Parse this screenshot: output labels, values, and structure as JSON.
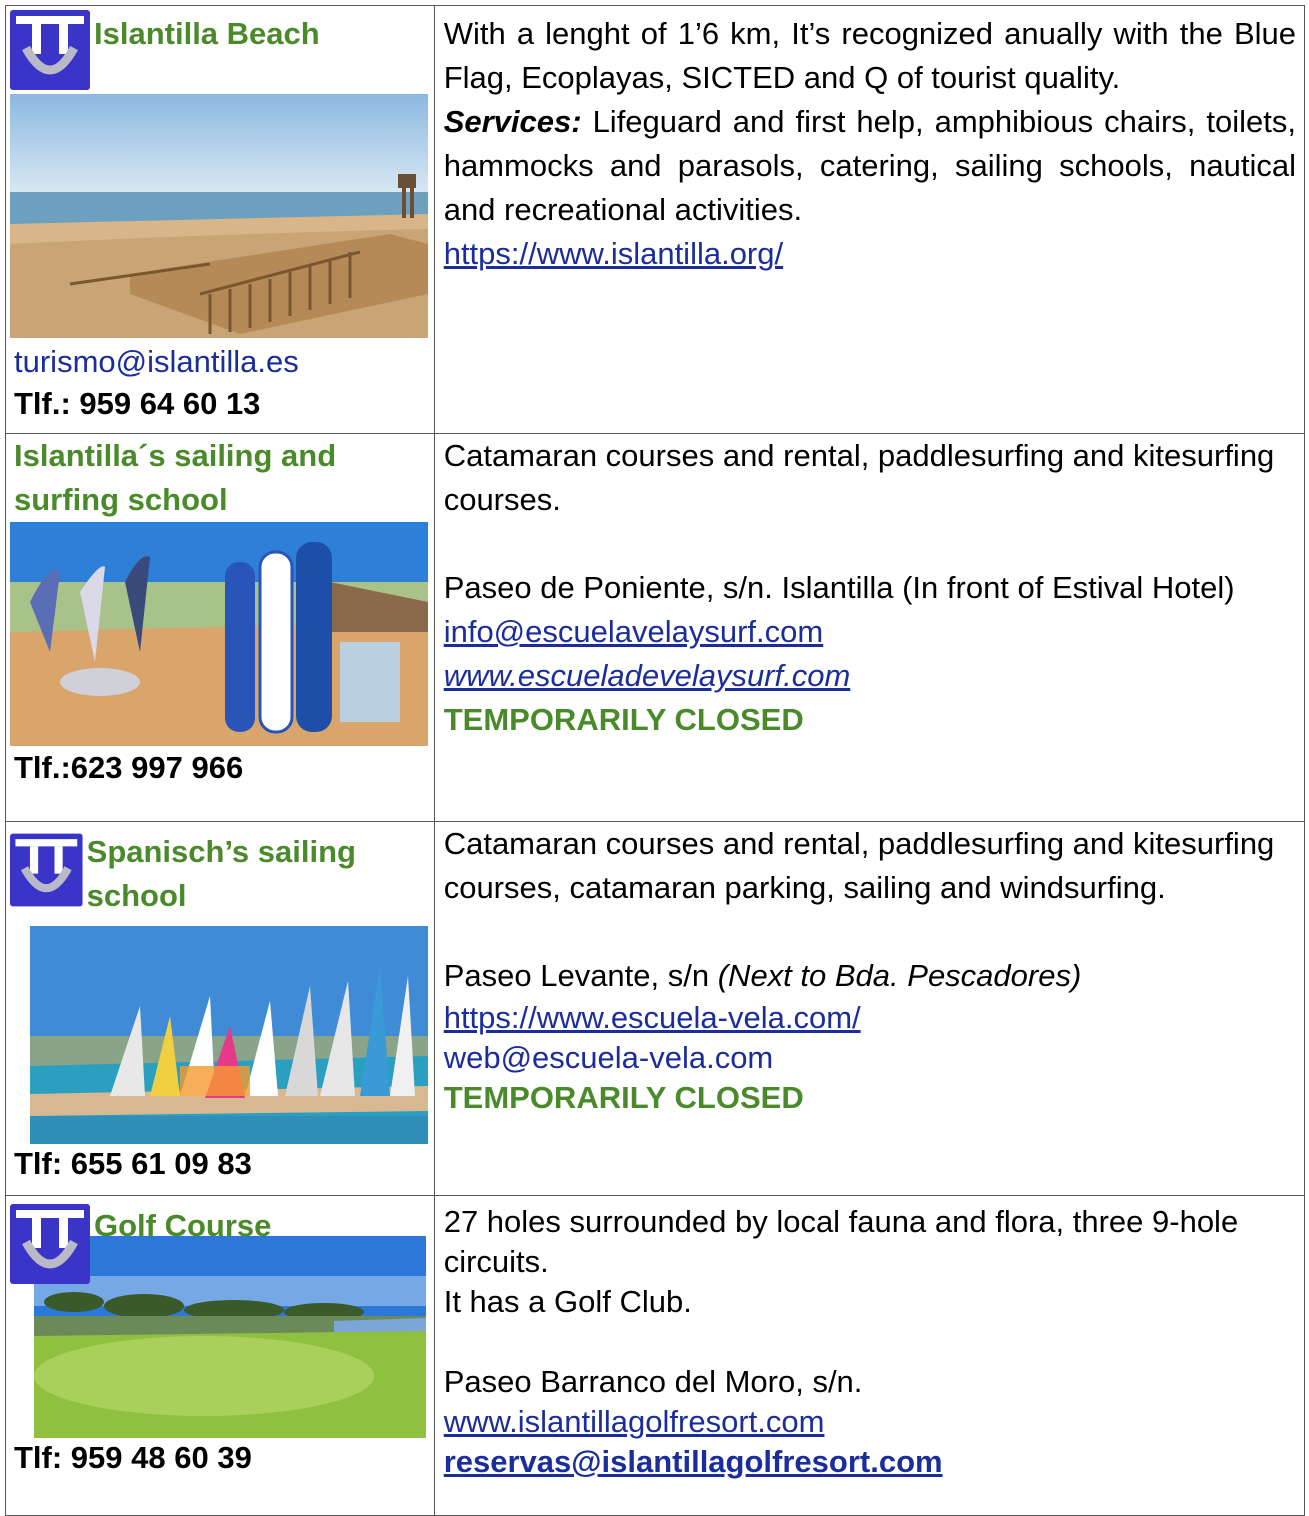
{
  "rows": [
    {
      "title": "Islantilla Beach",
      "email": "turismo@islantilla.es",
      "phone": "Tlf.: 959 64 60 13",
      "description": "With a lenght of 1’6 km, It’s recognized anually with the Blue Flag, Ecoplayas, SICTED and Q of tourist quality.",
      "services_label": "Services:",
      "services_text": " Lifeguard and first help, amphibious chairs,  toilets, hammocks and parasols, catering, sailing schools, nautical and recreational activities.",
      "website": "https://www.islantilla.org/"
    },
    {
      "title": "Islantilla´s sailing and surfing school",
      "phone": "Tlf.:623 997 966",
      "description": "Catamaran courses and rental, paddlesurfing and kitesurfing courses.",
      "address": "Paseo de Poniente, s/n.  Islantilla (In front of Estival Hotel)",
      "email": "info@escuelavelaysurf.com",
      "website": "www.escueladevelaysurf.com",
      "status": "TEMPORARILY CLOSED"
    },
    {
      "title": "Spanisch’s sailing school",
      "phone": "Tlf: 655 61 09 83",
      "description": "Catamaran courses and rental, paddlesurfing and kitesurfing courses, catamaran parking, sailing and windsurfing.",
      "address": "Paseo Levante, s/n ",
      "address_note": "(Next to Bda. Pescadores)",
      "website": "https://www.escuela-vela.com/",
      "email": "web@escuela-vela.com",
      "status": "TEMPORARILY CLOSED"
    },
    {
      "title": "Golf Course",
      "phone": "Tlf: 959 48 60 39",
      "description": "27 holes surrounded by local fauna and flora, three 9-hole circuits.",
      "description2": "It has a Golf Club.",
      "address": "Paseo Barranco del Moro, s/n.",
      "website": "www.islantillagolfresort.com",
      "email": "reservas@islantillagolfresort.com"
    }
  ],
  "colors": {
    "title_green": "#4a8a2b",
    "link_blue": "#1b2d9b",
    "logo_blue": "#3a35c8"
  },
  "icons": {
    "logo": "islantilla-logo-icon"
  }
}
